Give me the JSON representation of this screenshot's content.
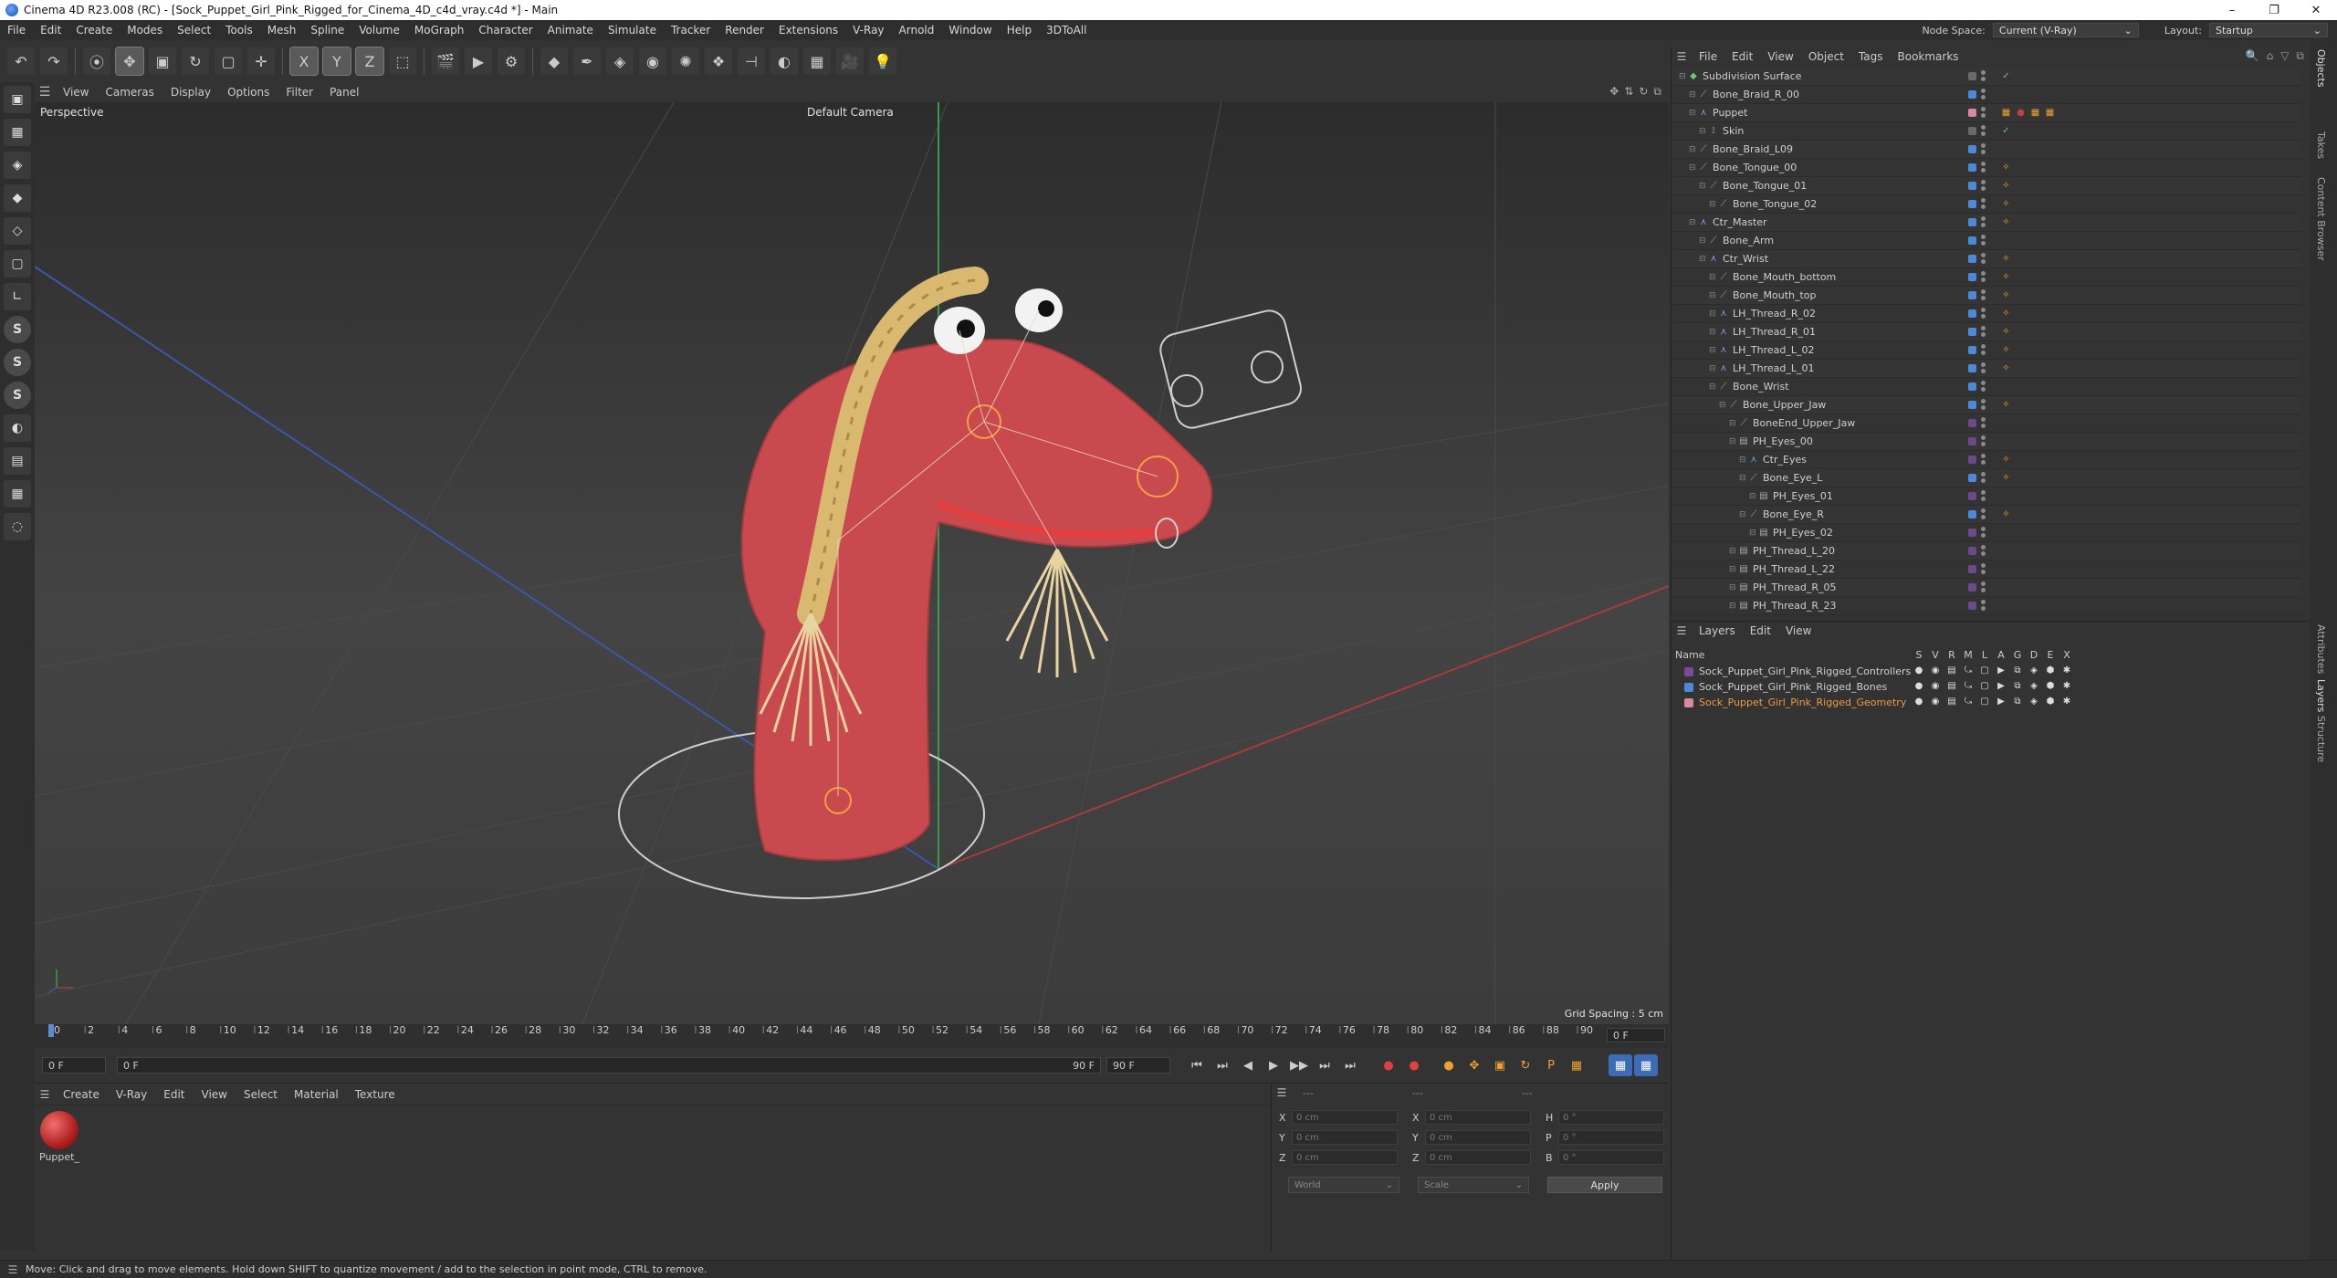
{
  "window": {
    "title": "Cinema 4D R23.008 (RC) - [Sock_Puppet_Girl_Pink_Rigged_for_Cinema_4D_c4d_vray.c4d *] - Main",
    "controls": [
      "–",
      "❐",
      "✕"
    ]
  },
  "menubar": {
    "items": [
      "File",
      "Edit",
      "Create",
      "Modes",
      "Select",
      "Tools",
      "Mesh",
      "Spline",
      "Volume",
      "MoGraph",
      "Character",
      "Animate",
      "Simulate",
      "Tracker",
      "Render",
      "Extensions",
      "V-Ray",
      "Arnold",
      "Window",
      "Help",
      "3DToAll"
    ],
    "node_space_label": "Node Space:",
    "node_space_value": "Current (V-Ray)",
    "layout_label": "Layout:",
    "layout_value": "Startup"
  },
  "toolbar": {
    "buttons": [
      {
        "name": "undo",
        "glyph": "↶"
      },
      {
        "name": "redo",
        "glyph": "↷"
      },
      {
        "name": "live-select",
        "glyph": "⦿"
      },
      {
        "name": "move",
        "glyph": "✥"
      },
      {
        "name": "scale",
        "glyph": "▣"
      },
      {
        "name": "rotate",
        "glyph": "↻"
      },
      {
        "name": "recent",
        "glyph": "▢"
      },
      {
        "name": "add",
        "glyph": "✛"
      },
      {
        "name": "axis-x",
        "glyph": "X"
      },
      {
        "name": "axis-y",
        "glyph": "Y"
      },
      {
        "name": "axis-z",
        "glyph": "Z"
      },
      {
        "name": "coord-system",
        "glyph": "⬚"
      },
      {
        "name": "render-region",
        "glyph": "🎬"
      },
      {
        "name": "render-view",
        "glyph": "▶"
      },
      {
        "name": "render-settings",
        "glyph": "⚙"
      },
      {
        "name": "cube",
        "glyph": "◆"
      },
      {
        "name": "pen",
        "glyph": "✒"
      },
      {
        "name": "subdivision",
        "glyph": "◈"
      },
      {
        "name": "extrude",
        "glyph": "◉"
      },
      {
        "name": "cloner",
        "glyph": "✺"
      },
      {
        "name": "mograph",
        "glyph": "❖"
      },
      {
        "name": "deformer",
        "glyph": "⊣"
      },
      {
        "name": "field",
        "glyph": "◐"
      },
      {
        "name": "floor",
        "glyph": "▦"
      },
      {
        "name": "camera",
        "glyph": "🎥"
      },
      {
        "name": "light",
        "glyph": "💡"
      }
    ]
  },
  "leftbar": {
    "buttons": [
      "▣",
      "▦",
      "◈",
      "◆",
      "◇",
      "▢",
      "∟",
      "S",
      "S",
      "S",
      "◐",
      "▤",
      "▦",
      "◌"
    ]
  },
  "viewport": {
    "menu": [
      "View",
      "Cameras",
      "Display",
      "Options",
      "Filter",
      "Panel"
    ],
    "view_name": "Perspective",
    "camera_name": "Default Camera",
    "grid_spacing": "Grid Spacing : 5 cm",
    "nav_icons": [
      "✥",
      "⇅",
      "↻",
      "⧉"
    ]
  },
  "timeline": {
    "ticks": [
      0,
      2,
      4,
      6,
      8,
      10,
      12,
      14,
      16,
      18,
      20,
      22,
      24,
      26,
      28,
      30,
      32,
      34,
      36,
      38,
      40,
      42,
      44,
      46,
      48,
      50,
      52,
      54,
      56,
      58,
      60,
      62,
      64,
      66,
      68,
      70,
      72,
      74,
      76,
      78,
      80,
      82,
      84,
      86,
      88,
      90
    ],
    "current_frame_label": "0 F",
    "start_frame": "0 F",
    "preview_start": "0 F",
    "preview_end": "90 F",
    "end_frame": "90 F"
  },
  "playback": {
    "buttons": [
      "⏮",
      "⏭",
      "◀",
      "▶",
      "▶▶",
      "⏭",
      "⏭"
    ],
    "record_buttons": [
      "●",
      "●"
    ],
    "key_buttons": [
      "●",
      "✥",
      "▣",
      "↻",
      "P",
      "▦"
    ],
    "extra_buttons": [
      "▦",
      "▦"
    ]
  },
  "material_manager": {
    "menu": [
      "Create",
      "V-Ray",
      "Edit",
      "View",
      "Select",
      "Material",
      "Texture"
    ],
    "materials": [
      {
        "label": "Puppet_"
      }
    ]
  },
  "coordinates": {
    "header": "---",
    "rows": [
      {
        "a": "X",
        "av": "0 cm",
        "b": "X",
        "bv": "0 cm",
        "c": "H",
        "cv": "0 °"
      },
      {
        "a": "Y",
        "av": "0 cm",
        "b": "Y",
        "bv": "0 cm",
        "c": "P",
        "cv": "0 °"
      },
      {
        "a": "Z",
        "av": "0 cm",
        "b": "Z",
        "bv": "0 cm",
        "c": "B",
        "cv": "0 °"
      }
    ],
    "mode": "World",
    "scale_mode": "Scale",
    "apply": "Apply"
  },
  "status": {
    "message": "Move: Click and drag to move elements. Hold down SHIFT to quantize movement / add to the selection in point mode, CTRL to remove."
  },
  "object_manager": {
    "menu": [
      "File",
      "Edit",
      "View",
      "Object",
      "Tags",
      "Bookmarks"
    ],
    "header_icons": [
      "🔍",
      "⌂",
      "▽",
      "⧉"
    ],
    "objects": [
      {
        "name": "Subdivision Surface",
        "depth": 0,
        "icon": "◆",
        "icon_color": "#6fc86f",
        "layer": "#6a6a6a",
        "tags": [
          "✓"
        ]
      },
      {
        "name": "Bone_Braid_R_00",
        "depth": 1,
        "icon": "⟋",
        "icon_color": "#6fc86f",
        "layer": "#4a8ad8",
        "tags": []
      },
      {
        "name": "Puppet",
        "depth": 1,
        "icon": "⋏",
        "icon_color": "#7ab0e8",
        "layer": "#d98a9a",
        "tags": [
          "▦",
          "●",
          "▦",
          "▦"
        ]
      },
      {
        "name": "Skin",
        "depth": 2,
        "icon": "⟟",
        "icon_color": "#aaa",
        "layer": "#6a6a6a",
        "tags": [
          "✓"
        ]
      },
      {
        "name": "Bone_Braid_L09",
        "depth": 1,
        "icon": "⟋",
        "icon_color": "#6fc86f",
        "layer": "#4a8ad8",
        "tags": []
      },
      {
        "name": "Bone_Tongue_00",
        "depth": 1,
        "icon": "⟋",
        "icon_color": "#6fc86f",
        "layer": "#4a8ad8",
        "tags": [
          "✧"
        ]
      },
      {
        "name": "Bone_Tongue_01",
        "depth": 2,
        "icon": "⟋",
        "icon_color": "#6fc86f",
        "layer": "#4a8ad8",
        "tags": [
          "✧"
        ]
      },
      {
        "name": "Bone_Tongue_02",
        "depth": 3,
        "icon": "⟋",
        "icon_color": "#6fc86f",
        "layer": "#4a8ad8",
        "tags": [
          "✧"
        ]
      },
      {
        "name": "Ctr_Master",
        "depth": 1,
        "icon": "⋏",
        "icon_color": "#7ab0e8",
        "layer": "#4a8ad8",
        "tags": [
          "✧"
        ]
      },
      {
        "name": "Bone_Arm",
        "depth": 2,
        "icon": "⟋",
        "icon_color": "#6fc86f",
        "layer": "#4a8ad8",
        "tags": []
      },
      {
        "name": "Ctr_Wrist",
        "depth": 2,
        "icon": "⋏",
        "icon_color": "#7ab0e8",
        "layer": "#4a8ad8",
        "tags": [
          "✧"
        ]
      },
      {
        "name": "Bone_Mouth_bottom",
        "depth": 3,
        "icon": "⟋",
        "icon_color": "#6fc86f",
        "layer": "#4a8ad8",
        "tags": [
          "✧"
        ]
      },
      {
        "name": "Bone_Mouth_top",
        "depth": 3,
        "icon": "⟋",
        "icon_color": "#6fc86f",
        "layer": "#4a8ad8",
        "tags": [
          "✧"
        ]
      },
      {
        "name": "LH_Thread_R_02",
        "depth": 3,
        "icon": "⋏",
        "icon_color": "#7ab0e8",
        "layer": "#4a8ad8",
        "tags": [
          "✧"
        ]
      },
      {
        "name": "LH_Thread_R_01",
        "depth": 3,
        "icon": "⋏",
        "icon_color": "#7ab0e8",
        "layer": "#4a8ad8",
        "tags": [
          "✧"
        ]
      },
      {
        "name": "LH_Thread_L_02",
        "depth": 3,
        "icon": "⋏",
        "icon_color": "#7ab0e8",
        "layer": "#4a8ad8",
        "tags": [
          "✧"
        ]
      },
      {
        "name": "LH_Thread_L_01",
        "depth": 3,
        "icon": "⋏",
        "icon_color": "#7ab0e8",
        "layer": "#4a8ad8",
        "tags": [
          "✧"
        ]
      },
      {
        "name": "Bone_Wrist",
        "depth": 3,
        "icon": "⟋",
        "icon_color": "#6fc86f",
        "layer": "#4a8ad8",
        "tags": []
      },
      {
        "name": "Bone_Upper_Jaw",
        "depth": 4,
        "icon": "⟋",
        "icon_color": "#6fc86f",
        "layer": "#4a8ad8",
        "tags": [
          "✧"
        ]
      },
      {
        "name": "BoneEnd_Upper_Jaw",
        "depth": 5,
        "icon": "⟋",
        "icon_color": "#6fc86f",
        "layer": "#6a4a8a",
        "tags": []
      },
      {
        "name": "PH_Eyes_00",
        "depth": 5,
        "icon": "▤",
        "icon_color": "#aaa",
        "layer": "#6a4a8a",
        "tags": []
      },
      {
        "name": "Ctr_Eyes",
        "depth": 6,
        "icon": "⋏",
        "icon_color": "#7ab0e8",
        "layer": "#6a4a8a",
        "tags": [
          "✧"
        ]
      },
      {
        "name": "Bone_Eye_L",
        "depth": 6,
        "icon": "⟋",
        "icon_color": "#6fc86f",
        "layer": "#4a8ad8",
        "tags": [
          "✧"
        ]
      },
      {
        "name": "PH_Eyes_01",
        "depth": 7,
        "icon": "▤",
        "icon_color": "#aaa",
        "layer": "#6a4a8a",
        "tags": []
      },
      {
        "name": "Bone_Eye_R",
        "depth": 6,
        "icon": "⟋",
        "icon_color": "#6fc86f",
        "layer": "#4a8ad8",
        "tags": [
          "✧"
        ]
      },
      {
        "name": "PH_Eyes_02",
        "depth": 7,
        "icon": "▤",
        "icon_color": "#aaa",
        "layer": "#6a4a8a",
        "tags": []
      },
      {
        "name": "PH_Thread_L_20",
        "depth": 5,
        "icon": "▤",
        "icon_color": "#aaa",
        "layer": "#6a4a8a",
        "tags": []
      },
      {
        "name": "PH_Thread_L_22",
        "depth": 5,
        "icon": "▤",
        "icon_color": "#aaa",
        "layer": "#6a4a8a",
        "tags": []
      },
      {
        "name": "PH_Thread_R_05",
        "depth": 5,
        "icon": "▤",
        "icon_color": "#aaa",
        "layer": "#6a4a8a",
        "tags": []
      },
      {
        "name": "PH_Thread_R_23",
        "depth": 5,
        "icon": "▤",
        "icon_color": "#aaa",
        "layer": "#6a4a8a",
        "tags": []
      }
    ]
  },
  "layer_manager": {
    "menu": [
      "Layers",
      "Edit",
      "View"
    ],
    "col_name": "Name",
    "flag_headers": [
      "S",
      "V",
      "R",
      "M",
      "L",
      "A",
      "G",
      "D",
      "E",
      "X"
    ],
    "layers": [
      {
        "name": "Sock_Puppet_Girl_Pink_Rigged_Controllers",
        "color": "#7a4a9a",
        "highlight": false
      },
      {
        "name": "Sock_Puppet_Girl_Pink_Rigged_Bones",
        "color": "#4a8ad8",
        "highlight": false
      },
      {
        "name": "Sock_Puppet_Girl_Pink_Rigged_Geometry",
        "color": "#d98a9a",
        "highlight": true
      }
    ],
    "flag_glyphs": [
      "●",
      "◉",
      "▤",
      "⤿",
      "▢",
      "▶",
      "⧉",
      "◈",
      "⬢",
      "✱"
    ]
  },
  "right_tabs": [
    "Objects",
    "Takes",
    "Content Browser",
    "Attributes",
    "Layers",
    "Structure"
  ]
}
